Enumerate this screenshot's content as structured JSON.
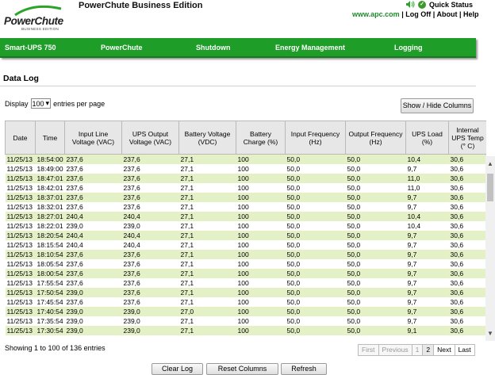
{
  "header": {
    "logo_text": "PowerChute",
    "logo_sub": "BUSINESS EDITION",
    "app_title": "PowerChute Business Edition",
    "quick_status": "Quick Status",
    "links": {
      "site": "www.apc.com",
      "logoff": "Log Off",
      "about": "About",
      "help": "Help",
      "sep": "|"
    }
  },
  "nav": [
    "Smart-UPS 750",
    "PowerChute",
    "Shutdown",
    "Energy Management",
    "Logging"
  ],
  "page": {
    "title": "Data Log",
    "display_prefix": "Display",
    "display_value": "100",
    "display_suffix": "entries per page",
    "show_hide": "Show / Hide Columns",
    "info": "Showing 1 to 100 of 136 entries"
  },
  "table": {
    "headers": [
      "Date",
      "Time",
      "Input Line Voltage (VAC)",
      "UPS Output Voltage (VAC)",
      "Battery Voltage (VDC)",
      "Battery Charge (%)",
      "Input Frequency (Hz)",
      "Output Frequency (Hz)",
      "UPS Load (%)",
      "Internal UPS Temp (° C)"
    ],
    "rows": [
      [
        "11/25/13",
        "18:54:00",
        "237,6",
        "237,6",
        "27,1",
        "100",
        "50,0",
        "50,0",
        "10,4",
        "30,6"
      ],
      [
        "11/25/13",
        "18:49:00",
        "237,6",
        "237,6",
        "27,1",
        "100",
        "50,0",
        "50,0",
        "9,7",
        "30,6"
      ],
      [
        "11/25/13",
        "18:47:01",
        "237,6",
        "237,6",
        "27,1",
        "100",
        "50,0",
        "50,0",
        "11,0",
        "30,6"
      ],
      [
        "11/25/13",
        "18:42:01",
        "237,6",
        "237,6",
        "27,1",
        "100",
        "50,0",
        "50,0",
        "11,0",
        "30,6"
      ],
      [
        "11/25/13",
        "18:37:01",
        "237,6",
        "237,6",
        "27,1",
        "100",
        "50,0",
        "50,0",
        "9,7",
        "30,6"
      ],
      [
        "11/25/13",
        "18:32:01",
        "237,6",
        "237,6",
        "27,1",
        "100",
        "50,0",
        "50,0",
        "9,7",
        "30,6"
      ],
      [
        "11/25/13",
        "18:27:01",
        "240,4",
        "240,4",
        "27,1",
        "100",
        "50,0",
        "50,0",
        "10,4",
        "30,6"
      ],
      [
        "11/25/13",
        "18:22:01",
        "239,0",
        "239,0",
        "27,1",
        "100",
        "50,0",
        "50,0",
        "10,4",
        "30,6"
      ],
      [
        "11/25/13",
        "18:20:54",
        "240,4",
        "240,4",
        "27,1",
        "100",
        "50,0",
        "50,0",
        "9,7",
        "30,6"
      ],
      [
        "11/25/13",
        "18:15:54",
        "240,4",
        "240,4",
        "27,1",
        "100",
        "50,0",
        "50,0",
        "9,7",
        "30,6"
      ],
      [
        "11/25/13",
        "18:10:54",
        "237,6",
        "237,6",
        "27,1",
        "100",
        "50,0",
        "50,0",
        "9,7",
        "30,6"
      ],
      [
        "11/25/13",
        "18:05:54",
        "237,6",
        "237,6",
        "27,1",
        "100",
        "50,0",
        "50,0",
        "9,7",
        "30,6"
      ],
      [
        "11/25/13",
        "18:00:54",
        "237,6",
        "237,6",
        "27,1",
        "100",
        "50,0",
        "50,0",
        "9,7",
        "30,6"
      ],
      [
        "11/25/13",
        "17:55:54",
        "237,6",
        "237,6",
        "27,1",
        "100",
        "50,0",
        "50,0",
        "9,7",
        "30,6"
      ],
      [
        "11/25/13",
        "17:50:54",
        "239,0",
        "237,6",
        "27,1",
        "100",
        "50,0",
        "50,0",
        "9,7",
        "30,6"
      ],
      [
        "11/25/13",
        "17:45:54",
        "237,6",
        "237,6",
        "27,1",
        "100",
        "50,0",
        "50,0",
        "9,7",
        "30,6"
      ],
      [
        "11/25/13",
        "17:40:54",
        "239,0",
        "239,0",
        "27,0",
        "100",
        "50,0",
        "50,0",
        "9,7",
        "30,6"
      ],
      [
        "11/25/13",
        "17:35:54",
        "239,0",
        "239,0",
        "27,1",
        "100",
        "50,0",
        "50,0",
        "9,7",
        "30,6"
      ],
      [
        "11/25/13",
        "17:30:54",
        "239,0",
        "239,0",
        "27,1",
        "100",
        "50,0",
        "50,0",
        "9,1",
        "30,6"
      ]
    ]
  },
  "pager": {
    "first": "First",
    "previous": "Previous",
    "page1": "1",
    "page2": "2",
    "next": "Next",
    "last": "Last"
  },
  "buttons": {
    "clear": "Clear Log",
    "reset": "Reset Columns",
    "refresh": "Refresh"
  },
  "colors": {
    "nav_green": "#1e9e28",
    "row_odd": "#e4f0c6",
    "link_green": "#1f8a2a"
  }
}
